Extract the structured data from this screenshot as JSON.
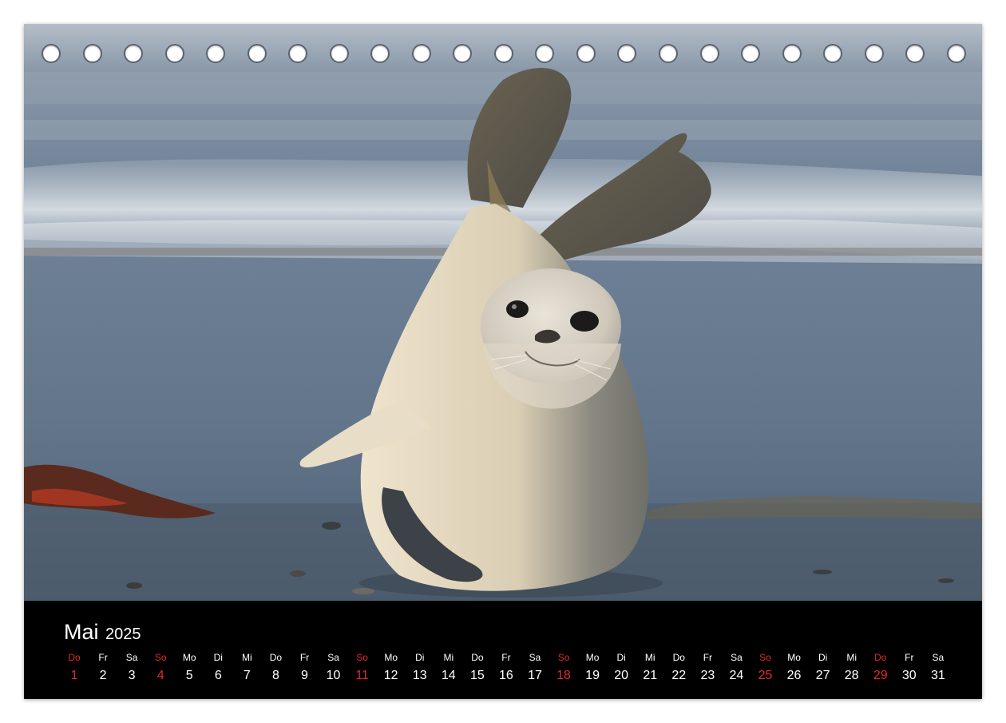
{
  "calendar": {
    "month": "Mai",
    "year": "2025",
    "holes": 23,
    "colors": {
      "background": "#000000",
      "text": "#ffffff",
      "sunday_holiday": "#e12a2a"
    },
    "days": [
      {
        "wd": "Do",
        "num": "1",
        "red": true
      },
      {
        "wd": "Fr",
        "num": "2",
        "red": false
      },
      {
        "wd": "Sa",
        "num": "3",
        "red": false
      },
      {
        "wd": "So",
        "num": "4",
        "red": true
      },
      {
        "wd": "Mo",
        "num": "5",
        "red": false
      },
      {
        "wd": "Di",
        "num": "6",
        "red": false
      },
      {
        "wd": "Mi",
        "num": "7",
        "red": false
      },
      {
        "wd": "Do",
        "num": "8",
        "red": false
      },
      {
        "wd": "Fr",
        "num": "9",
        "red": false
      },
      {
        "wd": "Sa",
        "num": "10",
        "red": false
      },
      {
        "wd": "So",
        "num": "11",
        "red": true
      },
      {
        "wd": "Mo",
        "num": "12",
        "red": false
      },
      {
        "wd": "Di",
        "num": "13",
        "red": false
      },
      {
        "wd": "Mi",
        "num": "14",
        "red": false
      },
      {
        "wd": "Do",
        "num": "15",
        "red": false
      },
      {
        "wd": "Fr",
        "num": "16",
        "red": false
      },
      {
        "wd": "Sa",
        "num": "17",
        "red": false
      },
      {
        "wd": "So",
        "num": "18",
        "red": true
      },
      {
        "wd": "Mo",
        "num": "19",
        "red": false
      },
      {
        "wd": "Di",
        "num": "20",
        "red": false
      },
      {
        "wd": "Mi",
        "num": "21",
        "red": false
      },
      {
        "wd": "Do",
        "num": "22",
        "red": false
      },
      {
        "wd": "Fr",
        "num": "23",
        "red": false
      },
      {
        "wd": "Sa",
        "num": "24",
        "red": false
      },
      {
        "wd": "So",
        "num": "25",
        "red": true
      },
      {
        "wd": "Mo",
        "num": "26",
        "red": false
      },
      {
        "wd": "Di",
        "num": "27",
        "red": false
      },
      {
        "wd": "Mi",
        "num": "28",
        "red": false
      },
      {
        "wd": "Do",
        "num": "29",
        "red": true
      },
      {
        "wd": "Fr",
        "num": "30",
        "red": false
      },
      {
        "wd": "Sa",
        "num": "31",
        "red": false
      }
    ]
  }
}
